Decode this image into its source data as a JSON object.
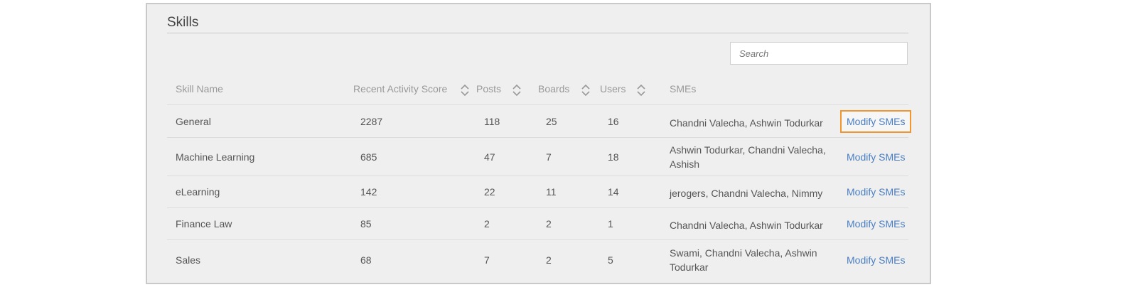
{
  "panel": {
    "title": "Skills",
    "search": {
      "placeholder": "Search",
      "value": ""
    }
  },
  "table": {
    "headers": {
      "skill_name": "Skill Name",
      "recent_activity_score": "Recent Activity Score",
      "posts": "Posts",
      "boards": "Boards",
      "users": "Users",
      "smes": "SMEs"
    },
    "rows": [
      {
        "skill": "General",
        "score": "2287",
        "posts": "118",
        "boards": "25",
        "users": "16",
        "smes": "Chandni Valecha, Ashwin Todurkar",
        "action": "Modify SMEs"
      },
      {
        "skill": "Machine Learning",
        "score": "685",
        "posts": "47",
        "boards": "7",
        "users": "18",
        "smes": "Ashwin Todurkar, Chandni Valecha, Ashish",
        "action": "Modify SMEs"
      },
      {
        "skill": "eLearning",
        "score": "142",
        "posts": "22",
        "boards": "11",
        "users": "14",
        "smes": "jerogers, Chandni Valecha, Nimmy",
        "action": "Modify SMEs"
      },
      {
        "skill": "Finance Law",
        "score": "85",
        "posts": "2",
        "boards": "2",
        "users": "1",
        "smes": "Chandni Valecha, Ashwin Todurkar",
        "action": "Modify SMEs"
      },
      {
        "skill": "Sales",
        "score": "68",
        "posts": "7",
        "boards": "2",
        "users": "5",
        "smes": "Swami, Chandni Valecha, Ashwin Todurkar",
        "action": "Modify SMEs"
      }
    ]
  },
  "colors": {
    "link": "#4a7fc1",
    "highlight": "#f0962c",
    "panel_bg": "#efefef"
  }
}
